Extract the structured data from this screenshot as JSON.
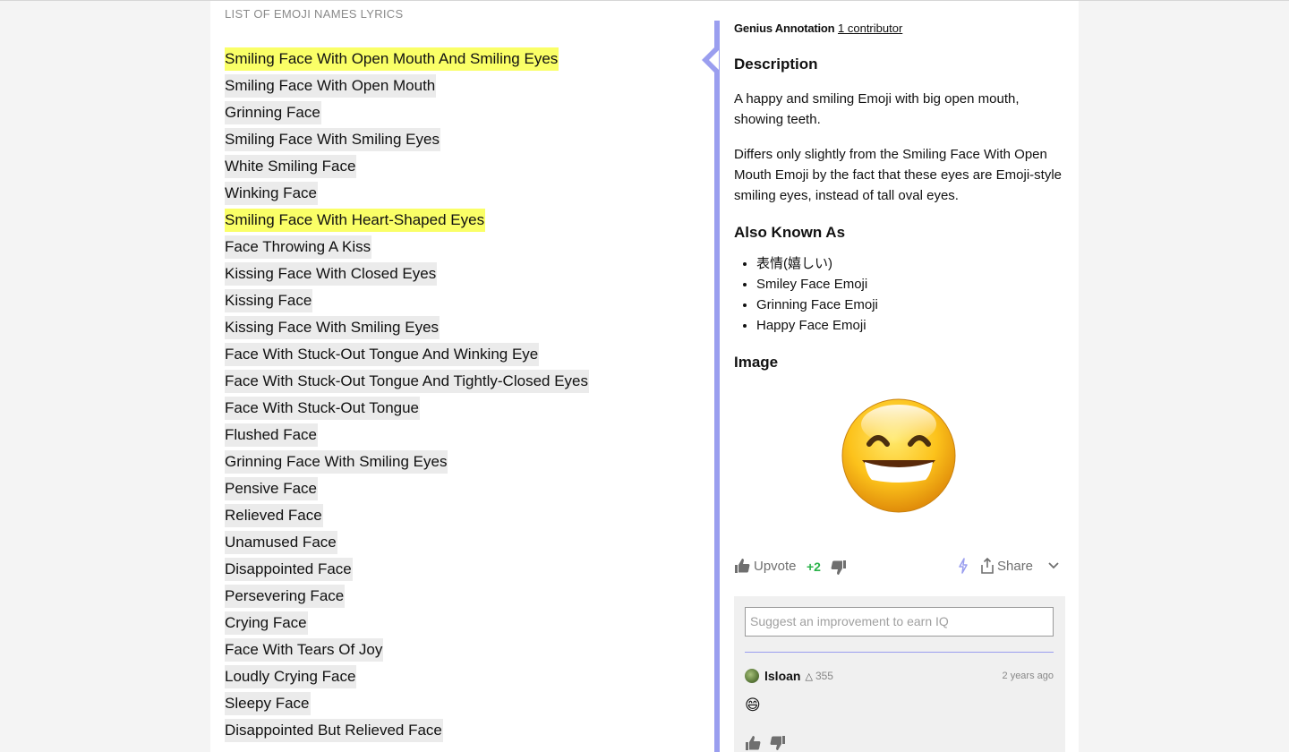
{
  "lyrics": {
    "header": "LIST OF EMOJI NAMES LYRICS",
    "lines": [
      {
        "text": "Smiling Face With Open Mouth And Smiling Eyes",
        "highlighted": true
      },
      {
        "text": "Smiling Face With Open Mouth",
        "highlighted": false
      },
      {
        "text": "Grinning Face",
        "highlighted": false
      },
      {
        "text": "Smiling Face With Smiling Eyes",
        "highlighted": false
      },
      {
        "text": "White Smiling Face",
        "highlighted": false
      },
      {
        "text": "Winking Face",
        "highlighted": false
      },
      {
        "text": "Smiling Face With Heart-Shaped Eyes",
        "highlighted": true
      },
      {
        "text": "Face Throwing A Kiss",
        "highlighted": false
      },
      {
        "text": "Kissing Face With Closed Eyes",
        "highlighted": false
      },
      {
        "text": "Kissing Face",
        "highlighted": false
      },
      {
        "text": "Kissing Face With Smiling Eyes",
        "highlighted": false
      },
      {
        "text": "Face With Stuck-Out Tongue And Winking Eye",
        "highlighted": false
      },
      {
        "text": "Face With Stuck-Out Tongue And Tightly-Closed Eyes",
        "highlighted": false
      },
      {
        "text": "Face With Stuck-Out Tongue",
        "highlighted": false
      },
      {
        "text": "Flushed Face",
        "highlighted": false
      },
      {
        "text": "Grinning Face With Smiling Eyes",
        "highlighted": false
      },
      {
        "text": "Pensive Face",
        "highlighted": false
      },
      {
        "text": "Relieved Face",
        "highlighted": false
      },
      {
        "text": "Unamused Face",
        "highlighted": false
      },
      {
        "text": "Disappointed Face",
        "highlighted": false
      },
      {
        "text": "Persevering Face",
        "highlighted": false
      },
      {
        "text": "Crying Face",
        "highlighted": false
      },
      {
        "text": "Face With Tears Of Joy",
        "highlighted": false
      },
      {
        "text": "Loudly Crying Face",
        "highlighted": false
      },
      {
        "text": "Sleepy Face",
        "highlighted": false
      },
      {
        "text": "Disappointed But Relieved Face",
        "highlighted": false
      }
    ]
  },
  "annotation": {
    "type_label": "Genius Annotation",
    "contributors_link": "1 contributor",
    "description_heading": "Description",
    "description_p1": "A happy and smiling Emoji with big open mouth, showing teeth.",
    "description_p2": "Differs only slightly from the Smiling Face With Open Mouth Emoji by the fact that these eyes are Emoji-style smiling eyes, instead of tall oval eyes.",
    "aka_heading": "Also Known As",
    "aka": [
      "表情(嬉しい)",
      "Smiley Face Emoji",
      "Grinning Face Emoji",
      "Happy Face Emoji"
    ],
    "image_heading": "Image",
    "image_icon": "grinning-smiling-eyes-emoji",
    "upvote_label": "Upvote",
    "vote_count": "+2",
    "share_label": "Share",
    "accent_color": "#9a9eef"
  },
  "comments": {
    "placeholder": "Suggest an improvement to earn IQ",
    "items": [
      {
        "username": "lsloan",
        "iq": "355",
        "timestamp": "2 years ago",
        "body": "😄"
      }
    ]
  },
  "colors": {
    "highlight": "#faff67",
    "unhighlighted": "#ebebeb",
    "vote_positive": "#2bb34a"
  }
}
